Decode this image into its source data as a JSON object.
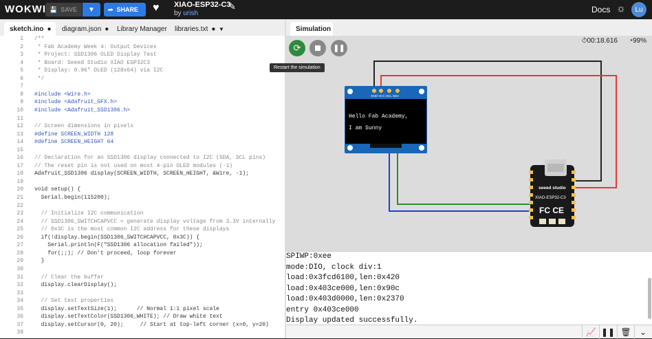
{
  "header": {
    "logo": "WOKWI",
    "save_label": "SAVE",
    "share_label": "SHARE",
    "project_title": "XIAO-ESP32-C3",
    "by_prefix": "by",
    "author": "urish",
    "docs_label": "Docs",
    "avatar_initials": "Lu"
  },
  "editor_tabs": [
    {
      "label": "sketch.ino",
      "active": true
    },
    {
      "label": "diagram.json"
    },
    {
      "label": "Library Manager"
    },
    {
      "label": "libraries.txt"
    }
  ],
  "code_lines": [
    {
      "n": "1",
      "t": "/**"
    },
    {
      "n": "2",
      "t": " * Fab Academy Week 4: Output Devices"
    },
    {
      "n": "3",
      "t": " * Project: SSD1306 OLED Display Test"
    },
    {
      "n": "4",
      "t": " * Board: Seeed Studio XIAO ESP32C3"
    },
    {
      "n": "5",
      "t": " * Display: 0.96\" OLED (128x64) via I2C"
    },
    {
      "n": "6",
      "t": " */"
    },
    {
      "n": "7",
      "t": ""
    },
    {
      "n": "8",
      "t": "#include <Wire.h>"
    },
    {
      "n": "9",
      "t": "#include <Adafruit_GFX.h>"
    },
    {
      "n": "10",
      "t": "#include <Adafruit_SSD1306.h>"
    },
    {
      "n": "11",
      "t": ""
    },
    {
      "n": "12",
      "t": "// Screen dimensions in pixels"
    },
    {
      "n": "13",
      "t": "#define SCREEN_WIDTH 128"
    },
    {
      "n": "14",
      "t": "#define SCREEN_HEIGHT 64"
    },
    {
      "n": "15",
      "t": ""
    },
    {
      "n": "16",
      "t": "// Declaration for an SSD1306 display connected to I2C (SDA, SCL pins)"
    },
    {
      "n": "17",
      "t": "// The reset pin is not used on most 4-pin OLED modules (-1)"
    },
    {
      "n": "18",
      "t": "Adafruit_SSD1306 display(SCREEN_WIDTH, SCREEN_HEIGHT, &Wire, -1);"
    },
    {
      "n": "19",
      "t": ""
    },
    {
      "n": "20",
      "t": "void setup() {"
    },
    {
      "n": "21",
      "t": "  Serial.begin(115200);"
    },
    {
      "n": "22",
      "t": ""
    },
    {
      "n": "23",
      "t": "  // Initialize I2C communication"
    },
    {
      "n": "24",
      "t": "  // SSD1306_SWITCHCAPVCC = generate display voltage from 3.3V internally"
    },
    {
      "n": "25",
      "t": "  // 0x3C is the most common I2C address for these displays"
    },
    {
      "n": "26",
      "t": "  if(!display.begin(SSD1306_SWITCHCAPVCC, 0x3C)) {"
    },
    {
      "n": "27",
      "t": "    Serial.println(F(\"SSD1306 allocation failed\"));"
    },
    {
      "n": "28",
      "t": "    for(;;); // Don't proceed, loop forever"
    },
    {
      "n": "29",
      "t": "  }"
    },
    {
      "n": "30",
      "t": ""
    },
    {
      "n": "31",
      "t": "  // Clear the buffer"
    },
    {
      "n": "32",
      "t": "  display.clearDisplay();"
    },
    {
      "n": "33",
      "t": ""
    },
    {
      "n": "34",
      "t": "  // Set text properties"
    },
    {
      "n": "35",
      "t": "  display.setTextSize(1);      // Normal 1:1 pixel scale"
    },
    {
      "n": "36",
      "t": "  display.setTextColor(SSD1306_WHITE); // Draw white text"
    },
    {
      "n": "37",
      "t": "  display.setCursor(0, 20);     // Start at top-left corner (x=0, y=20)"
    },
    {
      "n": "38",
      "t": ""
    }
  ],
  "simulation": {
    "tab_label": "Simulation",
    "timer": "00:18.616",
    "cpu": "99%",
    "tooltip": "Restart the simulation",
    "oled_pins": "GND VCC SCL SDA",
    "oled_line1": "Hello Fab Academy,",
    "oled_line2": "I am Sunny",
    "board_brand": "seeed studio",
    "board_model": "XIAO-ESP32-C3",
    "board_marks": "FC CE",
    "wire_colors": {
      "gnd": "#222222",
      "vcc": "#e53935",
      "scl": "#1e40d8",
      "sda": "#2e8b2e"
    }
  },
  "console_lines": [
    "SPIWP:0xee",
    "mode:DIO, clock div:1",
    "load:0x3fcd6100,len:0x420",
    "load:0x403ce000,len:0x90c",
    "load:0x403d0000,len:0x2370",
    "entry 0x403ce000",
    "Display updated successfully."
  ]
}
